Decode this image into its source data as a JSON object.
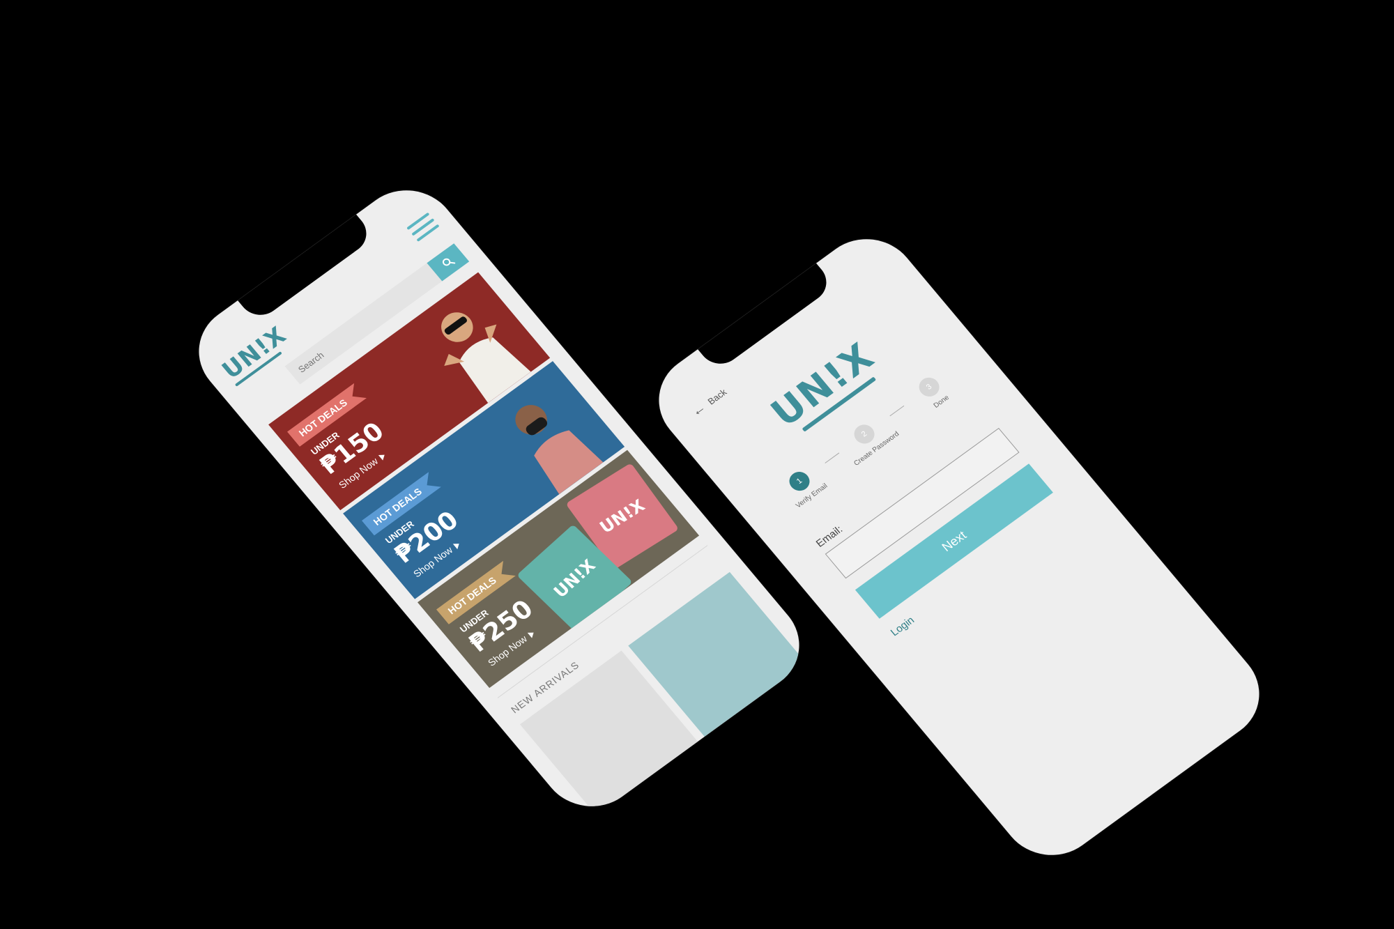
{
  "shop": {
    "logo": "UN!X",
    "search": {
      "placeholder": "Search"
    },
    "banners": [
      {
        "tag": "HOT DEALS",
        "under": "UNDER",
        "price": "₱150",
        "cta": "Shop Now"
      },
      {
        "tag": "HOT DEALS",
        "under": "UNDER",
        "price": "₱200",
        "cta": "Shop Now"
      },
      {
        "tag": "HOT DEALS",
        "under": "UNDER",
        "price": "₱250",
        "cta": "Shop Now"
      }
    ],
    "tee_print": "UN!X",
    "section_title": "NEW ARRIVALS"
  },
  "verify": {
    "back_label": "Back",
    "logo": "UN!X",
    "steps": [
      {
        "number": "1",
        "label": "Verify Email"
      },
      {
        "number": "2",
        "label": "Create Password"
      },
      {
        "number": "3",
        "label": "Done"
      }
    ],
    "email_label": "Email:",
    "email_value": "",
    "next_label": "Next",
    "login_label": "Login"
  },
  "colors": {
    "brand_teal": "#3f8f9a",
    "accent_teal": "#6cc3cc",
    "banner_red": "#8e2a26",
    "banner_blue": "#2f6b99",
    "banner_tan": "#6d6757",
    "background": "#000000",
    "screen": "#eeeeee"
  },
  "icons": {
    "menu": "hamburger-menu-icon",
    "search": "search-icon",
    "back": "back-arrow-icon",
    "shop_now": "play-arrow-icon"
  }
}
